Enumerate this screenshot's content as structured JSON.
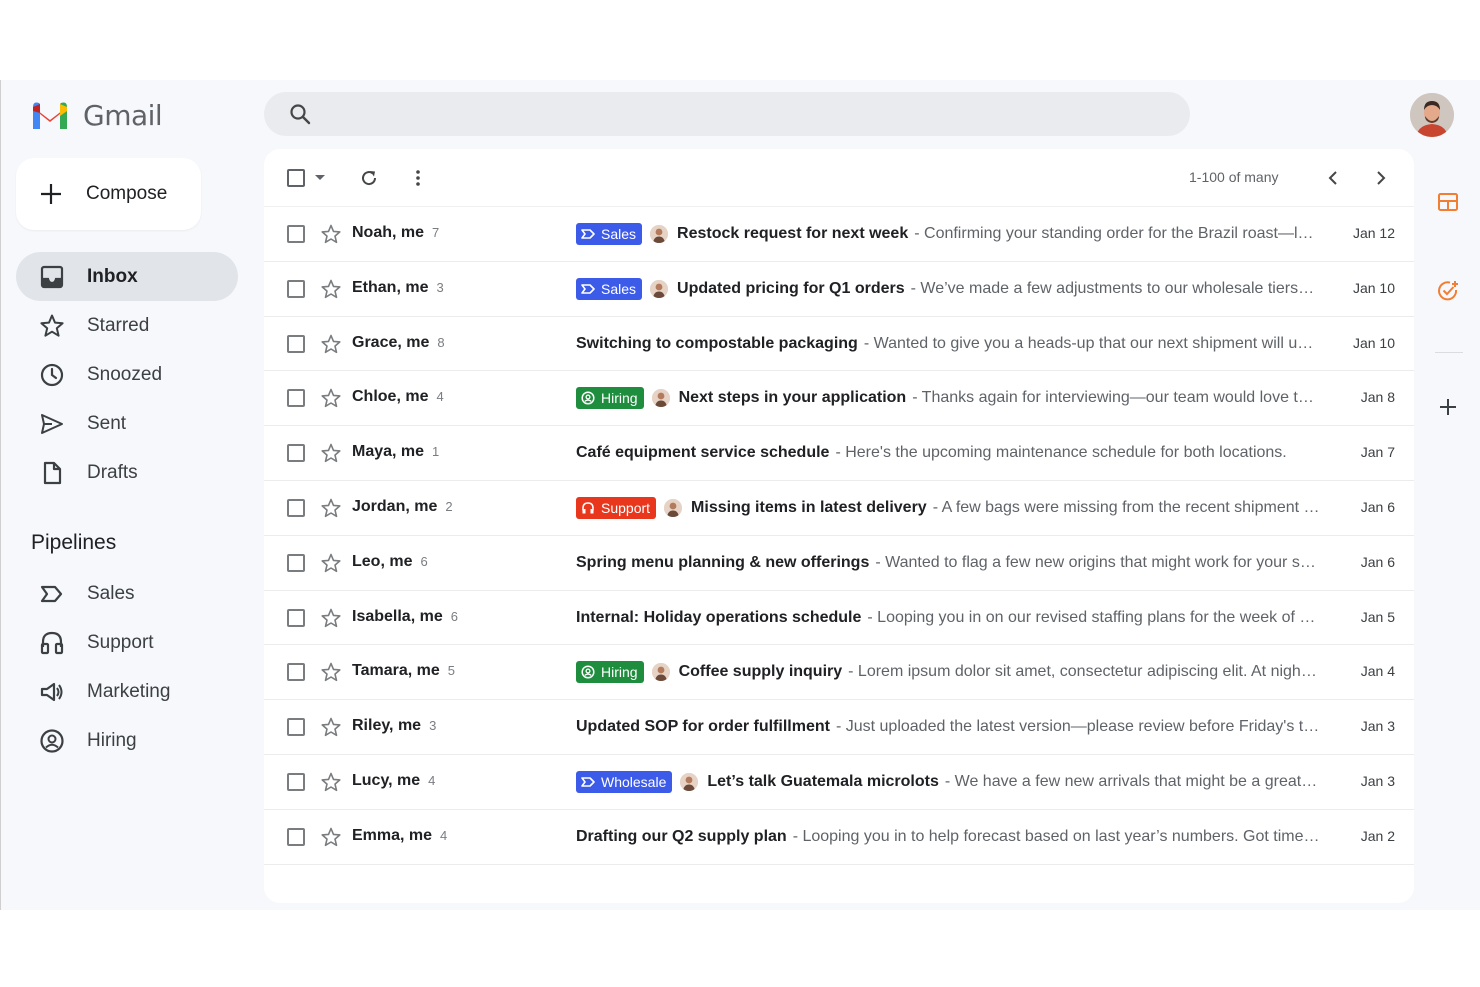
{
  "app": {
    "name": "Gmail"
  },
  "search": {
    "placeholder": ""
  },
  "compose": {
    "label": "Compose"
  },
  "nav": [
    {
      "label": "Inbox",
      "icon": "inbox-icon",
      "active": true
    },
    {
      "label": "Starred",
      "icon": "star-icon"
    },
    {
      "label": "Snoozed",
      "icon": "clock-icon"
    },
    {
      "label": "Sent",
      "icon": "send-icon"
    },
    {
      "label": "Drafts",
      "icon": "draft-icon"
    }
  ],
  "pipelines": {
    "title": "Pipelines",
    "items": [
      {
        "label": "Sales",
        "icon": "label-arrow-icon"
      },
      {
        "label": "Support",
        "icon": "headset-icon"
      },
      {
        "label": "Marketing",
        "icon": "megaphone-icon"
      },
      {
        "label": "Hiring",
        "icon": "person-circle-icon"
      }
    ]
  },
  "toolbar": {
    "count": "1-100 of many"
  },
  "colors": {
    "sales": "#3c5be8",
    "hiring": "#1e8e3e",
    "support": "#e8371c",
    "wholesale": "#3c5be8",
    "accent": "#f27e33"
  },
  "emails": [
    {
      "sender": "Noah, me",
      "count": "7",
      "label": "Sales",
      "labelType": "sales",
      "subject": "Restock request for next week",
      "snippet": "- Confirming your standing order for the Brazil roast—let…",
      "date": "Jan 12"
    },
    {
      "sender": "Ethan, me",
      "count": "3",
      "label": "Sales",
      "labelType": "sales",
      "subject": "Updated pricing for Q1 orders",
      "snippet": "- We’ve made a few adjustments to our wholesale tiers—…",
      "date": "Jan 10"
    },
    {
      "sender": "Grace, me",
      "count": "8",
      "label": "",
      "labelType": "",
      "subject": "Switching to compostable packaging",
      "snippet": "- Wanted to give you a heads-up that our next shipment will us…",
      "date": "Jan 10"
    },
    {
      "sender": "Chloe, me",
      "count": "4",
      "label": "Hiring",
      "labelType": "hiring",
      "subject": "Next steps in your application",
      "snippet": "- Thanks again for interviewing—our team would love to…",
      "date": "Jan 8"
    },
    {
      "sender": "Maya, me",
      "count": "1",
      "label": "",
      "labelType": "",
      "subject": "Café equipment service schedule",
      "snippet": "- Here's the upcoming maintenance schedule for both locations.",
      "date": "Jan 7"
    },
    {
      "sender": "Jordan, me",
      "count": "2",
      "label": "Support",
      "labelType": "support",
      "subject": "Missing items in latest delivery",
      "snippet": "- A few bags were missing from the recent shipment t…",
      "date": "Jan 6"
    },
    {
      "sender": "Leo, me",
      "count": "6",
      "label": "",
      "labelType": "",
      "subject": "Spring menu planning & new offerings",
      "snippet": "- Wanted to flag a few new origins that might work for your sea…",
      "date": "Jan 6"
    },
    {
      "sender": "Isabella, me",
      "count": "6",
      "label": "",
      "labelType": "",
      "subject": "Internal: Holiday operations schedule",
      "snippet": "- Looping you in on our revised staffing plans for the week of De…",
      "date": "Jan 5"
    },
    {
      "sender": "Tamara, me",
      "count": "5",
      "label": "Hiring",
      "labelType": "hiring",
      "subject": "Coffee supply inquiry",
      "snippet": "- Lorem ipsum dolor sit amet, consectetur adipiscing elit. At night…",
      "date": "Jan 4"
    },
    {
      "sender": "Riley, me",
      "count": "3",
      "label": "",
      "labelType": "",
      "subject": "Updated SOP for order fulfillment",
      "snippet": "- Just uploaded the latest version—please review before Friday's tra…",
      "date": "Jan 3"
    },
    {
      "sender": "Lucy, me",
      "count": "4",
      "label": "Wholesale",
      "labelType": "wholesale",
      "subject": "Let’s talk Guatemala microlots",
      "snippet": "- We have a few new arrivals that might be a great fit…",
      "date": "Jan 3"
    },
    {
      "sender": "Emma, me",
      "count": "4",
      "label": "",
      "labelType": "",
      "subject": "Drafting our Q2 supply plan",
      "snippet": "- Looping you in to help forecast based on last year’s numbers. Got time t…",
      "date": "Jan 2"
    }
  ]
}
